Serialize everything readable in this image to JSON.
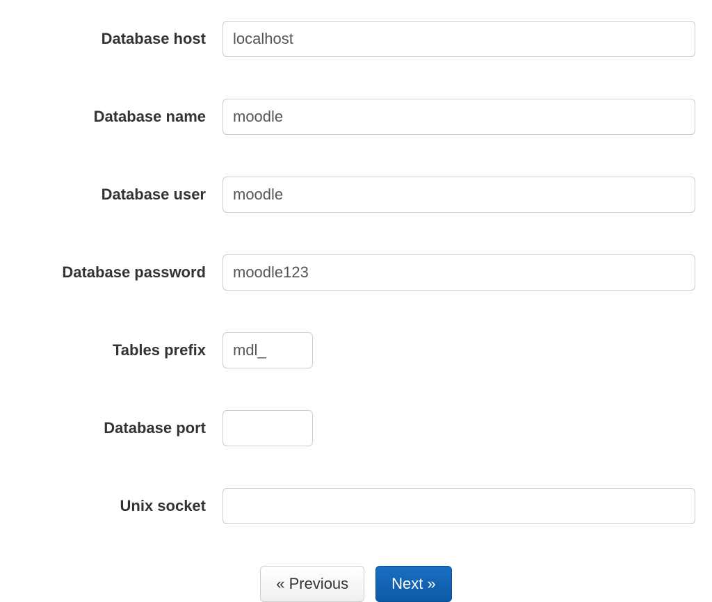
{
  "fields": {
    "db_host": {
      "label": "Database host",
      "value": "localhost"
    },
    "db_name": {
      "label": "Database name",
      "value": "moodle"
    },
    "db_user": {
      "label": "Database user",
      "value": "moodle"
    },
    "db_password": {
      "label": "Database password",
      "value": "moodle123"
    },
    "tables_prefix": {
      "label": "Tables prefix",
      "value": "mdl_"
    },
    "db_port": {
      "label": "Database port",
      "value": ""
    },
    "unix_socket": {
      "label": "Unix socket",
      "value": ""
    }
  },
  "buttons": {
    "previous": "« Previous",
    "next": "Next »"
  }
}
